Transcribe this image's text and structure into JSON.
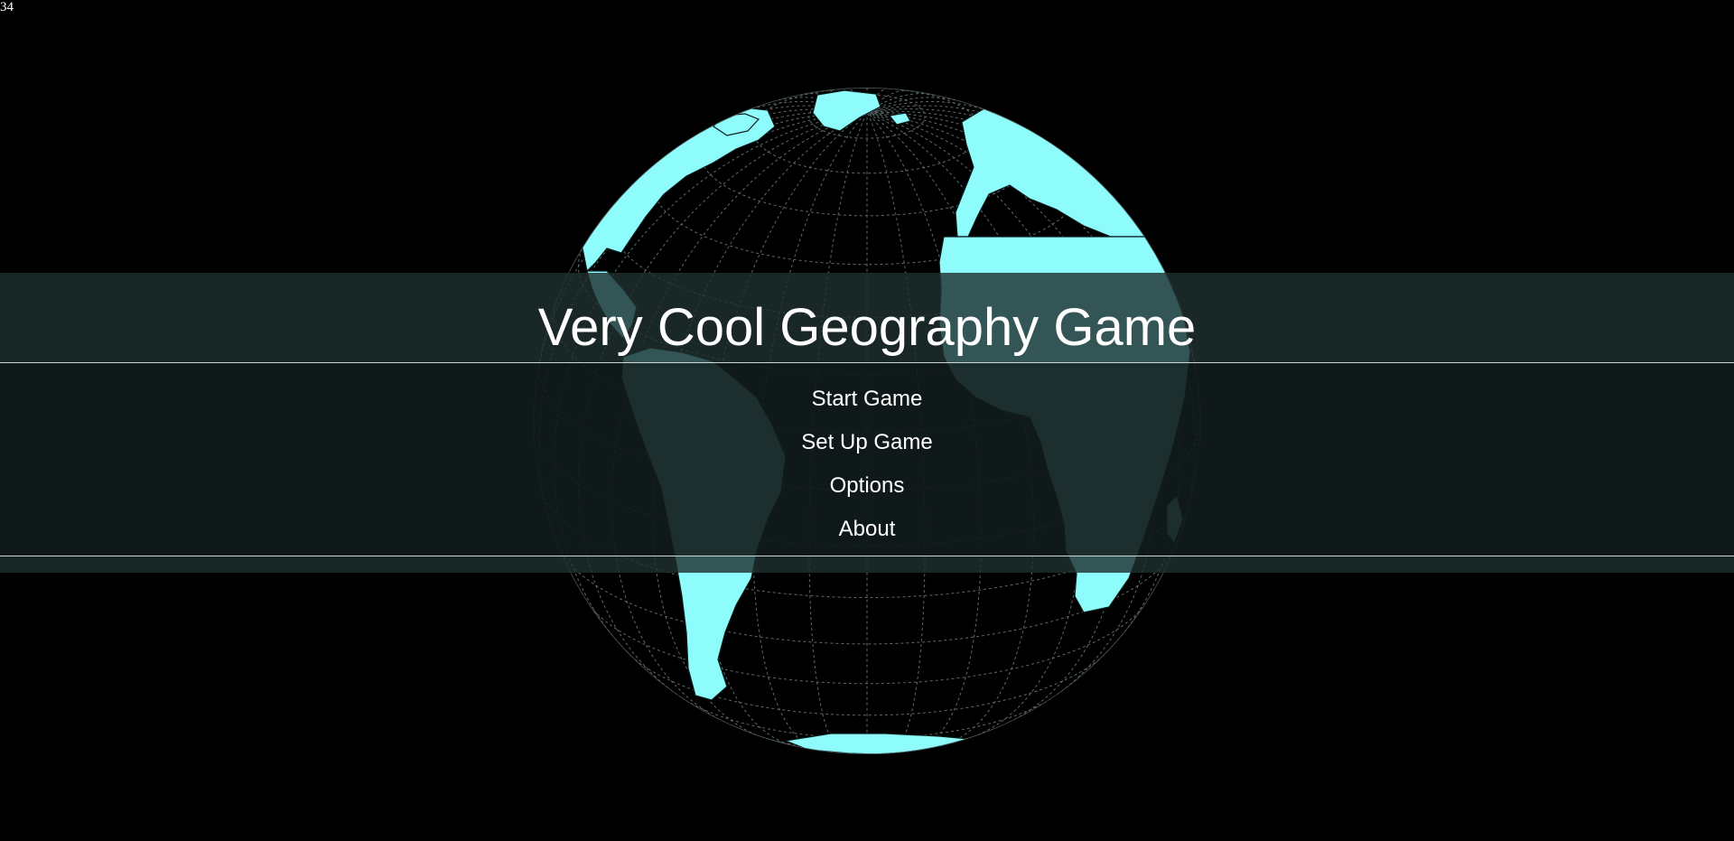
{
  "hud": {
    "fps": "34"
  },
  "title": "Very Cool Geography Game",
  "menu": {
    "items": [
      {
        "label": "Start Game"
      },
      {
        "label": "Set Up Game"
      },
      {
        "label": "Options"
      },
      {
        "label": "About"
      }
    ]
  },
  "colors": {
    "background": "#000000",
    "land": "#8ffcfc",
    "graticule": "#6a7474",
    "overlay": "#203030",
    "text": "#ffffff"
  }
}
